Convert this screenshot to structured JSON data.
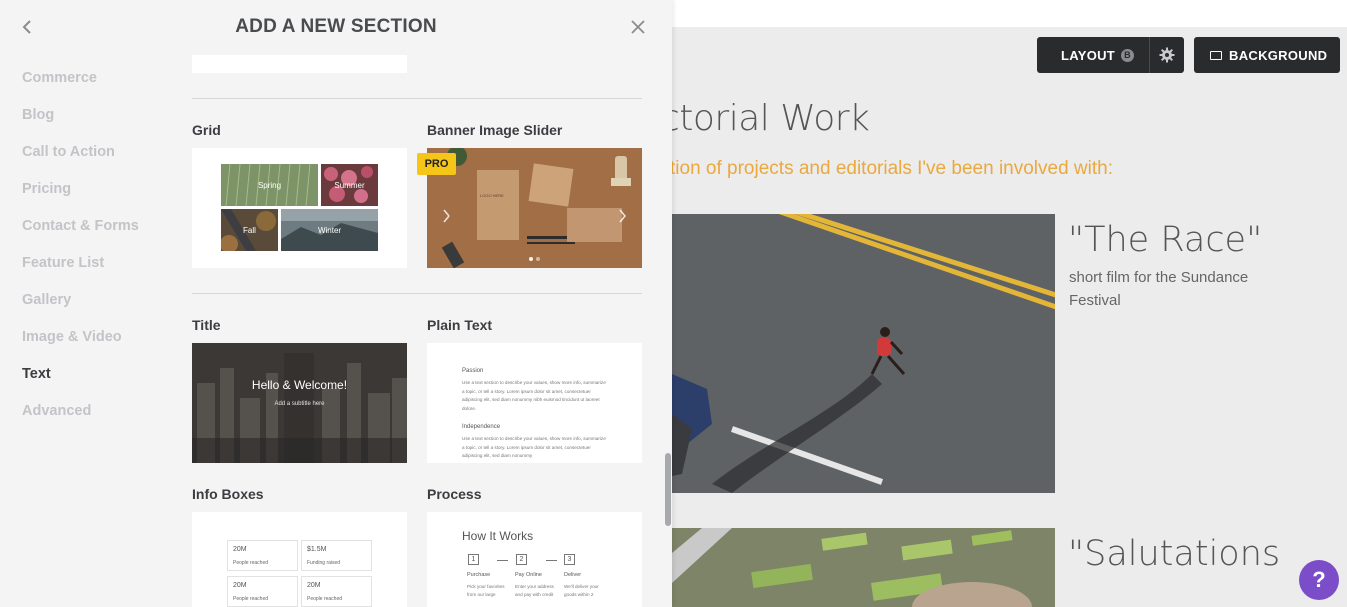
{
  "panel": {
    "title": "ADD A NEW SECTION",
    "categories": [
      "Commerce",
      "Blog",
      "Call to Action",
      "Pricing",
      "Contact & Forms",
      "Feature List",
      "Gallery",
      "Image & Video",
      "Text",
      "Advanced"
    ],
    "active_category": "Text"
  },
  "sections": {
    "grid": {
      "label": "Grid",
      "tiles": [
        "Spring",
        "Summer",
        "Fall",
        "Winter"
      ]
    },
    "banner": {
      "label": "Banner Image Slider",
      "badge": "PRO",
      "stamp_text": "LOGO HERE"
    },
    "title": {
      "label": "Title",
      "heading": "Hello & Welcome!",
      "subtitle": "Add a subtitle here"
    },
    "plain_text": {
      "label": "Plain Text",
      "h1": "Passion",
      "p1": "Use a text section to describe your values, show more info, summarize a topic, or tell a story. Lorem ipsum dolor sit amet, consectetuer adipiscing elit, sed diam nonummy nibh euismod tincidunt ut laoreet dolore.",
      "h2": "Independence",
      "p2": "Use a text section to describe your values, show more info, summarize a topic, or tell a story. Lorem ipsum dolor sit amet, consectetuer adipiscing elit, sed diam nonummy"
    },
    "info_boxes": {
      "label": "Info Boxes",
      "boxes": [
        {
          "value": "20M",
          "caption": "People reached"
        },
        {
          "value": "$1.5M",
          "caption": "Funding raised"
        },
        {
          "value": "20M",
          "caption": "People reached"
        },
        {
          "value": "20M",
          "caption": "People reached"
        }
      ]
    },
    "process": {
      "label": "Process",
      "heading": "How It Works",
      "steps": [
        {
          "num": "1",
          "name": "Purchase",
          "text": "Pick your favorites from our large"
        },
        {
          "num": "2",
          "name": "Pay Online",
          "text": "Enter your address and pay with credit"
        },
        {
          "num": "3",
          "name": "Deliver",
          "text": "We'll deliver your goods within 2"
        }
      ]
    }
  },
  "toolbar": {
    "layout_label": "LAYOUT",
    "layout_badge": "B",
    "background_label": "BACKGROUND"
  },
  "page": {
    "heading": "ctorial Work",
    "subheading": "tion of projects and editorials I've been involved with:",
    "works": [
      {
        "title": "\"The Race\"",
        "desc": "short film for the Sundance Festival"
      },
      {
        "title": "\"Salutations"
      }
    ]
  },
  "help": {
    "label": "?"
  },
  "colors": {
    "accent_orange": "#e9a93e",
    "toolbar_dark": "#2a2b2d",
    "pro_yellow": "#f5c518",
    "help_purple": "#7b4dc9"
  }
}
